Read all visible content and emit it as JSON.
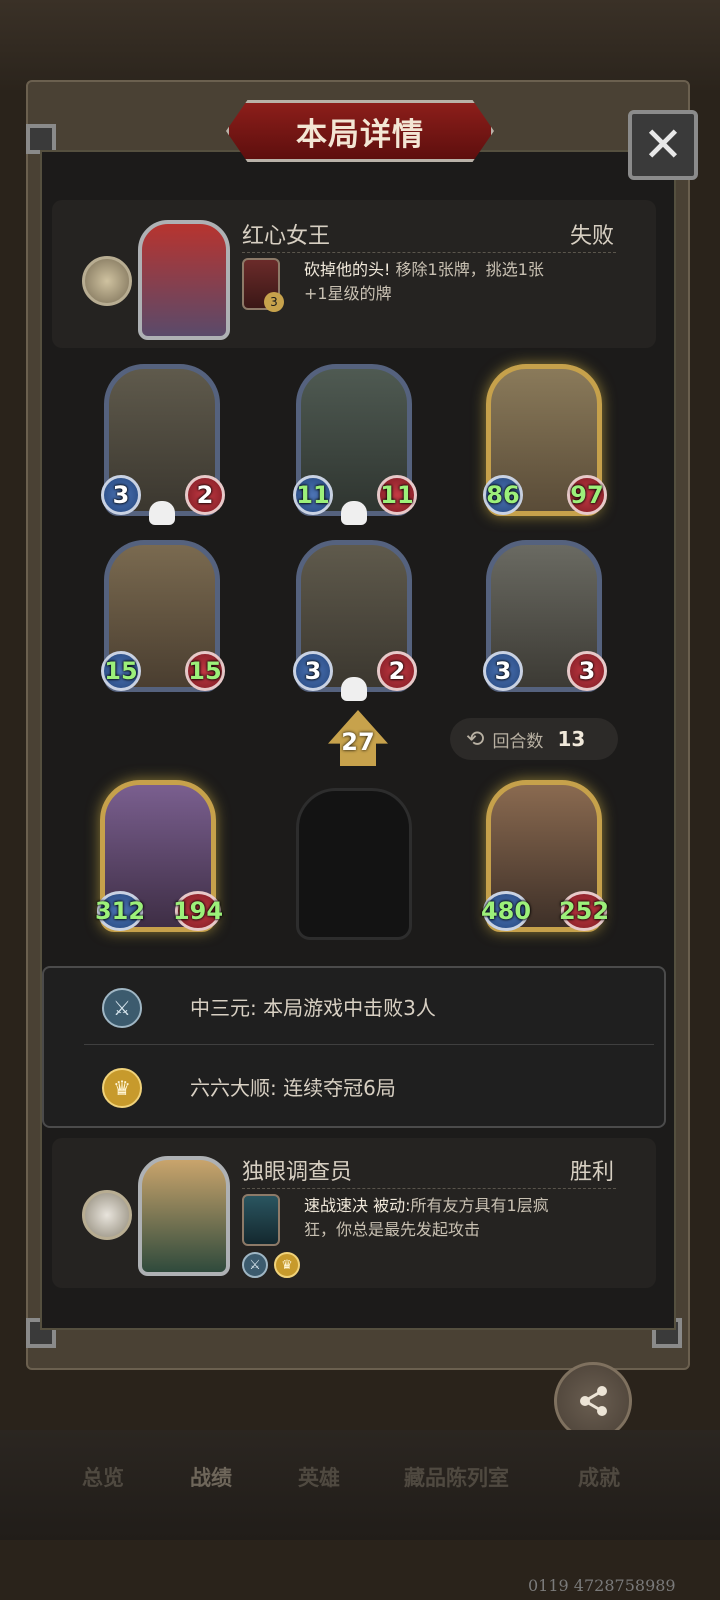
{
  "window": {
    "title": "本局详情",
    "close_symbol": "✕"
  },
  "opponent": {
    "hero_name": "红心女王",
    "result": "失败",
    "skill_name": "砍掉他的头!",
    "skill_desc_line1": "移除1张牌，挑选1张",
    "skill_desc_line2": "+1星级的牌",
    "skill_cost": "3"
  },
  "board_top": [
    {
      "attack": "3",
      "health": "2",
      "dead": true,
      "gold": false,
      "green": false
    },
    {
      "attack": "11",
      "health": "11",
      "dead": true,
      "gold": false,
      "green": true
    },
    {
      "attack": "86",
      "health": "97",
      "dead": false,
      "gold": true,
      "green": true
    },
    {
      "attack": "15",
      "health": "15",
      "dead": false,
      "gold": false,
      "green": true
    },
    {
      "attack": "3",
      "health": "2",
      "dead": true,
      "gold": false,
      "green": false
    },
    {
      "attack": "3",
      "health": "3",
      "dead": false,
      "gold": false,
      "green": false
    }
  ],
  "tavern_tier": "27",
  "round_info": {
    "label": "回合数",
    "value": "13"
  },
  "board_bottom": [
    {
      "attack": "312",
      "health": "194"
    },
    {
      "attack": "480",
      "health": "252"
    }
  ],
  "achievements": [
    {
      "icon": "crossed-swords-icon",
      "text": "中三元: 本局游戏中击败3人"
    },
    {
      "icon": "crown-icon",
      "text": "六六大顺: 连续夺冠6局"
    }
  ],
  "player": {
    "hero_name": "独眼调查员",
    "result": "胜利",
    "skill_name": "速战速决",
    "passive_label": "被动:",
    "skill_desc_line1": "所有友方具有1层疯",
    "skill_desc_line2": "狂，你总是最先发起攻击"
  },
  "share_label": "分享",
  "tabs": [
    "总览",
    "战绩",
    "英雄",
    "藏品陈列室",
    "成就"
  ],
  "uid_text": "0119 4728758989",
  "colors": {
    "title_red": "#8c1e1a",
    "frame_gold": "#c6a14b",
    "attack_blue": "#24467c",
    "health_red": "#7d1b23",
    "buff_green": "#9cf07a"
  }
}
